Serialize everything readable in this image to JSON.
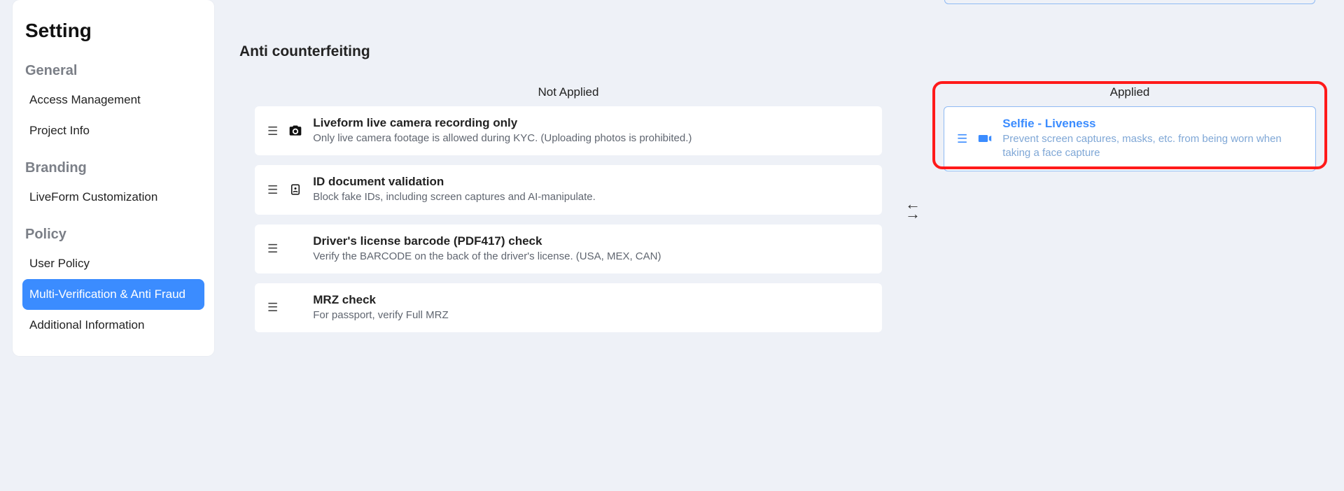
{
  "sidebar": {
    "title": "Setting",
    "groups": {
      "general": {
        "label": "General",
        "items": [
          "Access Management",
          "Project Info"
        ]
      },
      "branding": {
        "label": "Branding",
        "items": [
          "LiveForm Customization"
        ]
      },
      "policy": {
        "label": "Policy",
        "items": [
          "User Policy",
          "Multi-Verification & Anti Fraud",
          "Additional Information"
        ]
      }
    }
  },
  "section": {
    "title": "Anti counterfeiting",
    "not_applied_label": "Not Applied",
    "applied_label": "Applied"
  },
  "not_applied": [
    {
      "title": "Liveform live camera recording only",
      "desc": "Only live camera footage is allowed during KYC. (Uploading photos is prohibited.)",
      "icon": "camera"
    },
    {
      "title": "ID document validation",
      "desc": "Block fake IDs, including screen captures and AI-manipulate.",
      "icon": "id-card"
    },
    {
      "title": "Driver's license barcode (PDF417) check",
      "desc": "Verify the BARCODE on the back of the driver's license. (USA, MEX, CAN)",
      "icon": ""
    },
    {
      "title": "MRZ check",
      "desc": "For passport, verify Full MRZ",
      "icon": ""
    }
  ],
  "applied": [
    {
      "title": "Selfie - Liveness",
      "desc": "Prevent screen captures, masks, etc. from being worn when taking a face capture",
      "icon": "video"
    }
  ]
}
